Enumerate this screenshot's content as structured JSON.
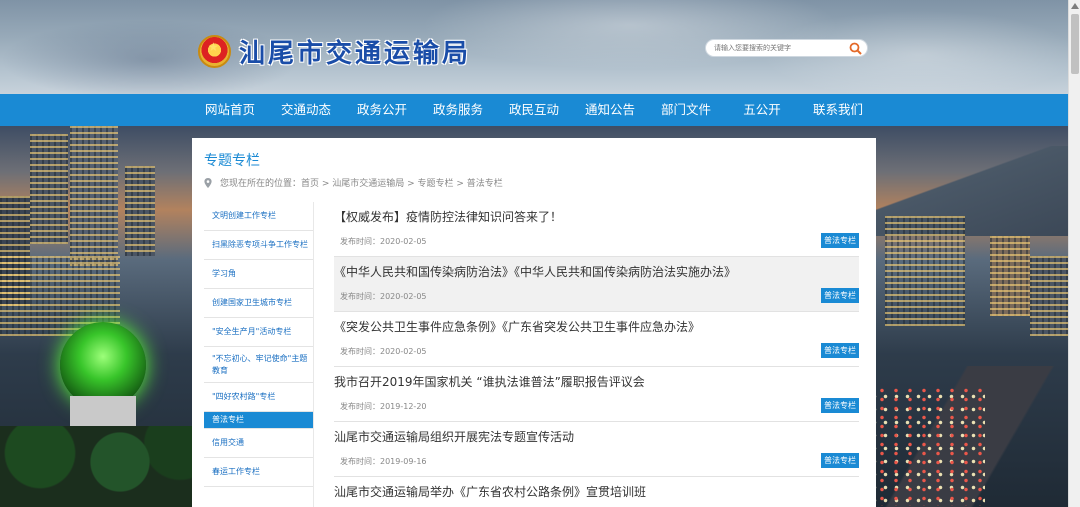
{
  "header": {
    "site_title": "汕尾市交通运输局",
    "search_placeholder": "请输入您要搜索的关键字"
  },
  "nav": {
    "items": [
      "网站首页",
      "交通动态",
      "政务公开",
      "政务服务",
      "政民互动",
      "通知公告",
      "部门文件",
      "五公开",
      "联系我们"
    ]
  },
  "section": {
    "title": "专题专栏",
    "breadcrumb": "您现在所在的位置：首页 > 汕尾市交通运输局 > 专题专栏 > 普法专栏"
  },
  "sidebar": {
    "items": [
      {
        "label": "文明创建工作专栏",
        "active": false
      },
      {
        "label": "扫黑除恶专项斗争工作专栏",
        "active": false
      },
      {
        "label": "学习角",
        "active": false
      },
      {
        "label": "创建国家卫生城市专栏",
        "active": false
      },
      {
        "label": "\"安全生产月\"活动专栏",
        "active": false
      },
      {
        "label": "\"不忘初心、牢记使命\"主题教育",
        "active": false
      },
      {
        "label": "\"四好农村路\"专栏",
        "active": false
      },
      {
        "label": "普法专栏",
        "active": true
      },
      {
        "label": "信用交通",
        "active": false
      },
      {
        "label": "春运工作专栏",
        "active": false
      }
    ]
  },
  "news": {
    "date_prefix": "发布时间：",
    "items": [
      {
        "title": "【权威发布】疫情防控法律知识问答来了！",
        "date": "2020-02-05",
        "tag": "普法专栏",
        "highlight": false
      },
      {
        "title": "《中华人民共和国传染病防治法》《中华人民共和国传染病防治法实施办法》",
        "date": "2020-02-05",
        "tag": "普法专栏",
        "highlight": true
      },
      {
        "title": "《突发公共卫生事件应急条例》《广东省突发公共卫生事件应急办法》",
        "date": "2020-02-05",
        "tag": "普法专栏",
        "highlight": false
      },
      {
        "title": "我市召开2019年国家机关 “谁执法谁普法”履职报告评议会",
        "date": "2019-12-20",
        "tag": "普法专栏",
        "highlight": false
      },
      {
        "title": "汕尾市交通运输局组织开展宪法专题宣传活动",
        "date": "2019-09-16",
        "tag": "普法专栏",
        "highlight": false
      },
      {
        "title": "汕尾市交通运输局举办《广东省农村公路条例》宣贯培训班",
        "date": "",
        "tag": "",
        "highlight": false
      }
    ]
  },
  "colors": {
    "accent": "#1a8ad4",
    "title_blue": "#1a4da8"
  }
}
